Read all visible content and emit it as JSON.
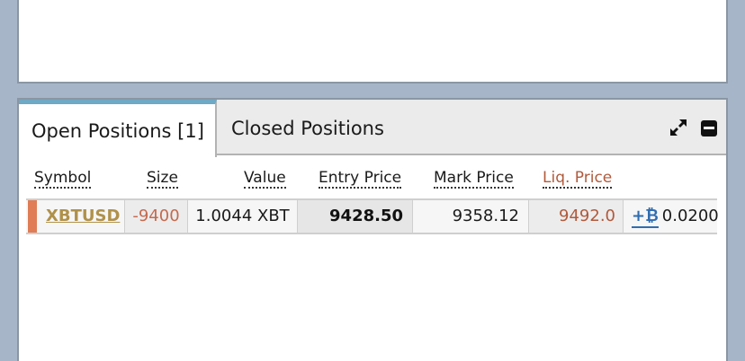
{
  "tabs": {
    "open_positions": "Open Positions [1]",
    "closed_positions": "Closed Positions"
  },
  "columns": {
    "symbol": "Symbol",
    "size": "Size",
    "value": "Value",
    "entry_price": "Entry Price",
    "mark_price": "Mark Price",
    "liq_price": "Liq. Price"
  },
  "position": {
    "symbol": "XBTUSD",
    "size": "-9400",
    "value": "1.0044 XBT",
    "entry_price": "9428.50",
    "mark_price": "9358.12",
    "liq_price": "9492.0",
    "margin_add_label": "+₿",
    "margin_value": "0.0200"
  },
  "icons": {
    "expand": "expand-icon",
    "minimize": "minimize-icon"
  },
  "colors": {
    "short_marker": "#e07c56",
    "active_tab_accent": "#6ea9c6",
    "symbol_link": "#b0914a",
    "negative": "#c46a4e",
    "liq_price": "#b05a3c",
    "margin_button": "#2f6db0"
  }
}
